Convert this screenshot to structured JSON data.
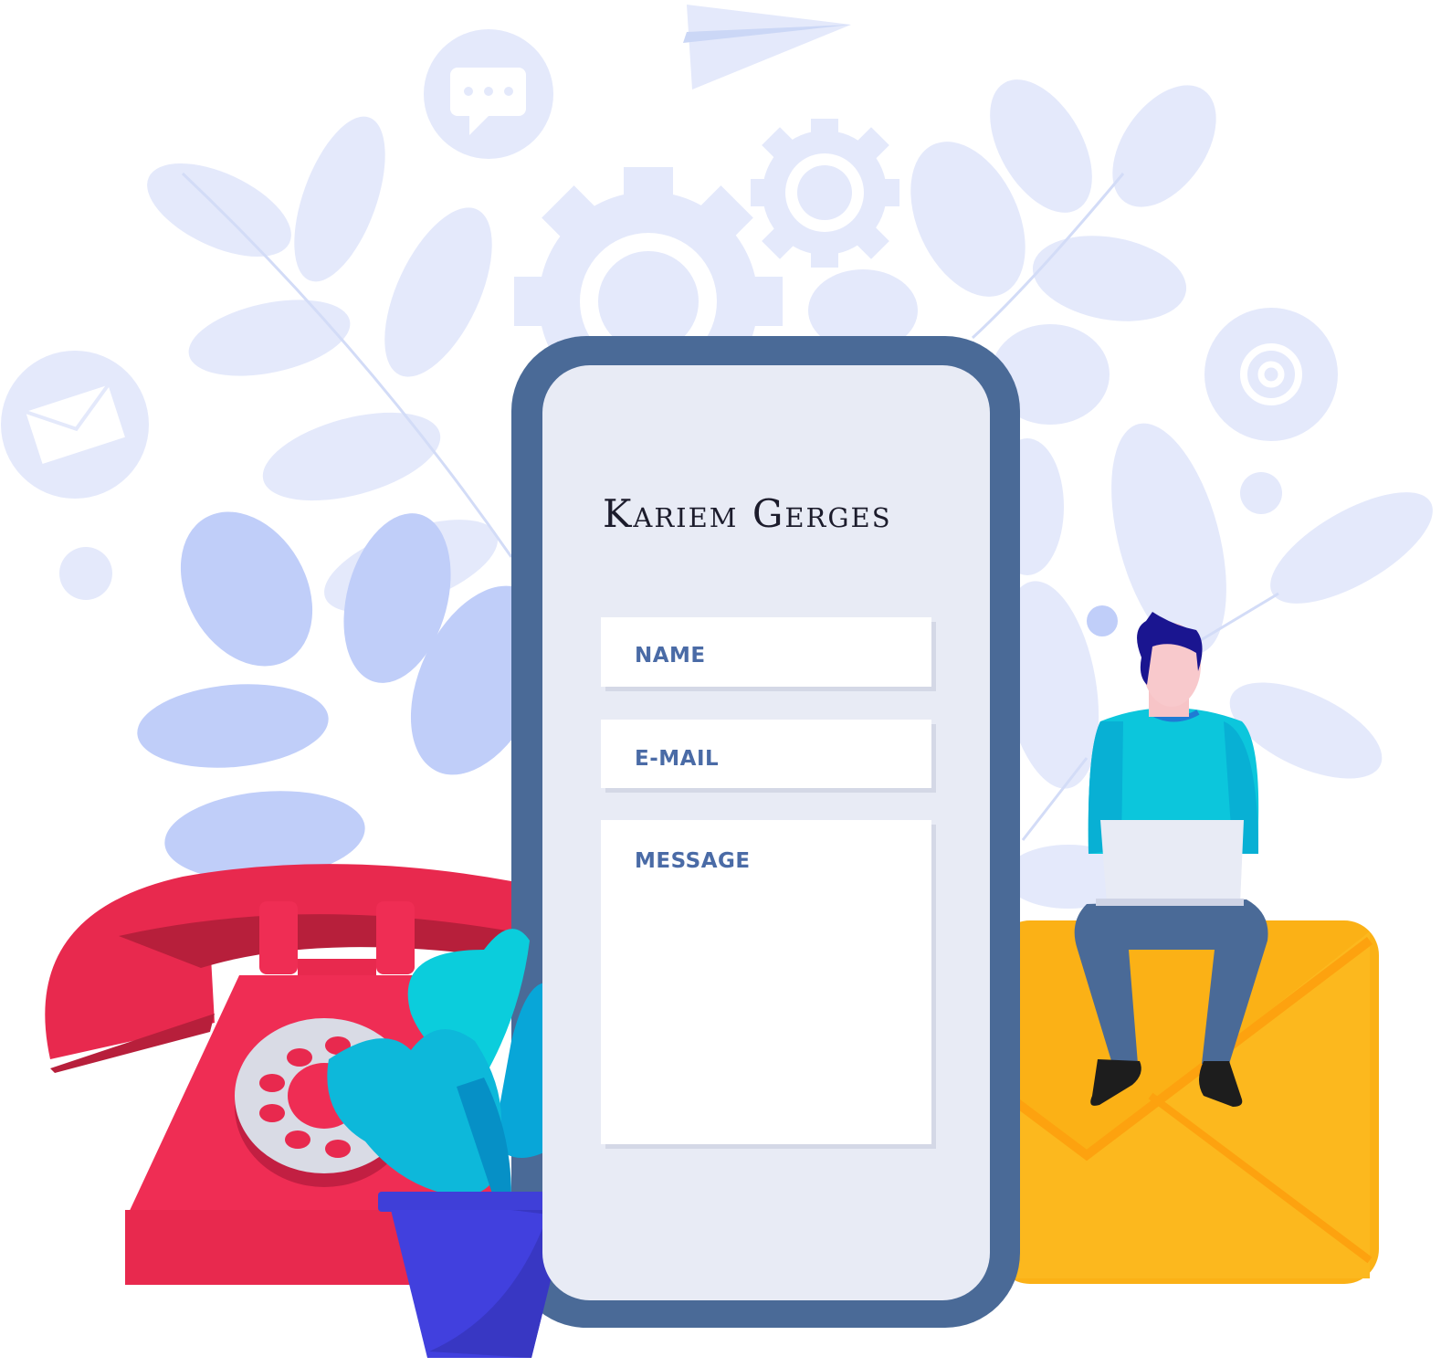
{
  "brand": {
    "name": "Kariem Gerges"
  },
  "form": {
    "fields": [
      {
        "label": "NAME"
      },
      {
        "label": "E-MAIL"
      },
      {
        "label": "MESSAGE"
      }
    ]
  },
  "icons": [
    "paper-plane-icon",
    "chat-bubble-icon",
    "gear-icon",
    "envelope-icon",
    "at-sign-icon",
    "telephone-icon",
    "potted-plant-icon",
    "person-with-laptop-icon",
    "leaf-icon"
  ],
  "colors": {
    "phone_frame": "#4a6a97",
    "phone_screen": "#e8ebf5",
    "field_text": "#4a6ba6",
    "background_shapes": "#e4e9fb",
    "telephone": "#ef2d54",
    "envelope": "#fbb116",
    "pot": "#4140de",
    "shirt": "#0cc6dc"
  }
}
